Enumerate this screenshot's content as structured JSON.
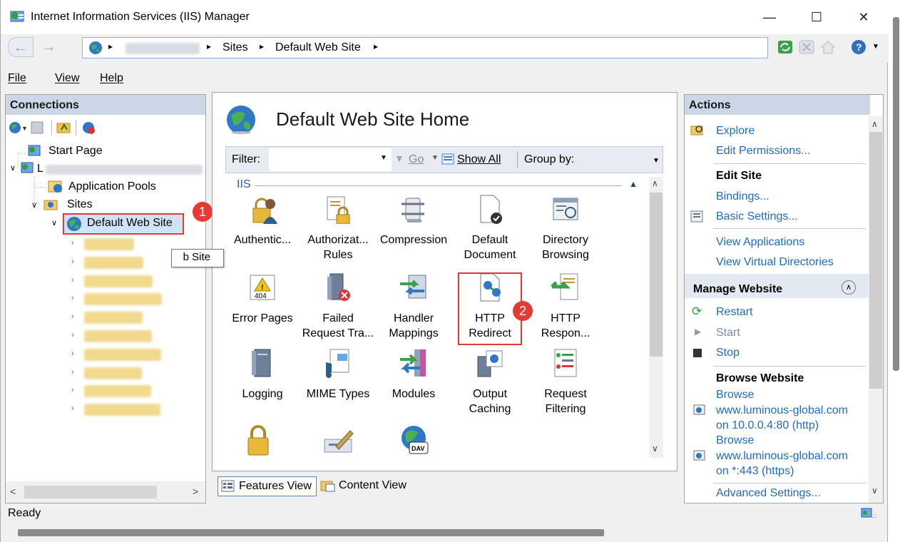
{
  "window": {
    "title": "Internet Information Services (IIS) Manager",
    "minimize": "—",
    "maximize": "☐",
    "close": "✕"
  },
  "address": {
    "separator": "▸",
    "crumb_sites": "Sites",
    "crumb_site": "Default Web Site"
  },
  "menu": {
    "file": "File",
    "view": "View",
    "help": "Help"
  },
  "connections": {
    "header": "Connections",
    "start_page": "Start Page",
    "server_prefix": "L",
    "app_pools": "Application Pools",
    "sites": "Sites",
    "default_site": "Default Web Site",
    "tooltip_suffix": "b Site"
  },
  "center": {
    "title": "Default Web Site Home",
    "filter_label": "Filter:",
    "go_label": "Go",
    "show_all": "Show All",
    "group_by": "Group by:",
    "group_label": "IIS",
    "features": [
      {
        "l1": "Authentic...",
        "l2": ""
      },
      {
        "l1": "Authorizat...",
        "l2": "Rules"
      },
      {
        "l1": "Compression",
        "l2": ""
      },
      {
        "l1": "Default",
        "l2": "Document"
      },
      {
        "l1": "Directory",
        "l2": "Browsing"
      },
      {
        "l1": "Error Pages",
        "l2": ""
      },
      {
        "l1": "Failed",
        "l2": "Request Tra..."
      },
      {
        "l1": "Handler",
        "l2": "Mappings"
      },
      {
        "l1": "HTTP",
        "l2": "Redirect"
      },
      {
        "l1": "HTTP",
        "l2": "Respon..."
      },
      {
        "l1": "Logging",
        "l2": ""
      },
      {
        "l1": "MIME Types",
        "l2": ""
      },
      {
        "l1": "Modules",
        "l2": ""
      },
      {
        "l1": "Output",
        "l2": "Caching"
      },
      {
        "l1": "Request",
        "l2": "Filtering"
      }
    ],
    "features_view": "Features View",
    "content_view": "Content View"
  },
  "actions": {
    "header": "Actions",
    "explore": "Explore",
    "edit_permissions": "Edit Permissions...",
    "edit_site": "Edit Site",
    "bindings": "Bindings...",
    "basic_settings": "Basic Settings...",
    "view_applications": "View Applications",
    "view_virtual_dirs": "View Virtual Directories",
    "manage_website": "Manage Website",
    "restart": "Restart",
    "start": "Start",
    "stop": "Stop",
    "browse_website": "Browse Website",
    "browse1_l1": "Browse",
    "browse1_l2": "www.luminous-global.com",
    "browse1_l3": "on 10.0.0.4:80 (http)",
    "browse2_l1": "Browse",
    "browse2_l2": "www.luminous-global.com",
    "browse2_l3": "on *:443 (https)",
    "advanced": "Advanced Settings..."
  },
  "status": {
    "text": "Ready"
  },
  "badges": {
    "one": "1",
    "two": "2"
  },
  "icons": {
    "globe": "globe-icon",
    "folder": "folder-icon"
  }
}
